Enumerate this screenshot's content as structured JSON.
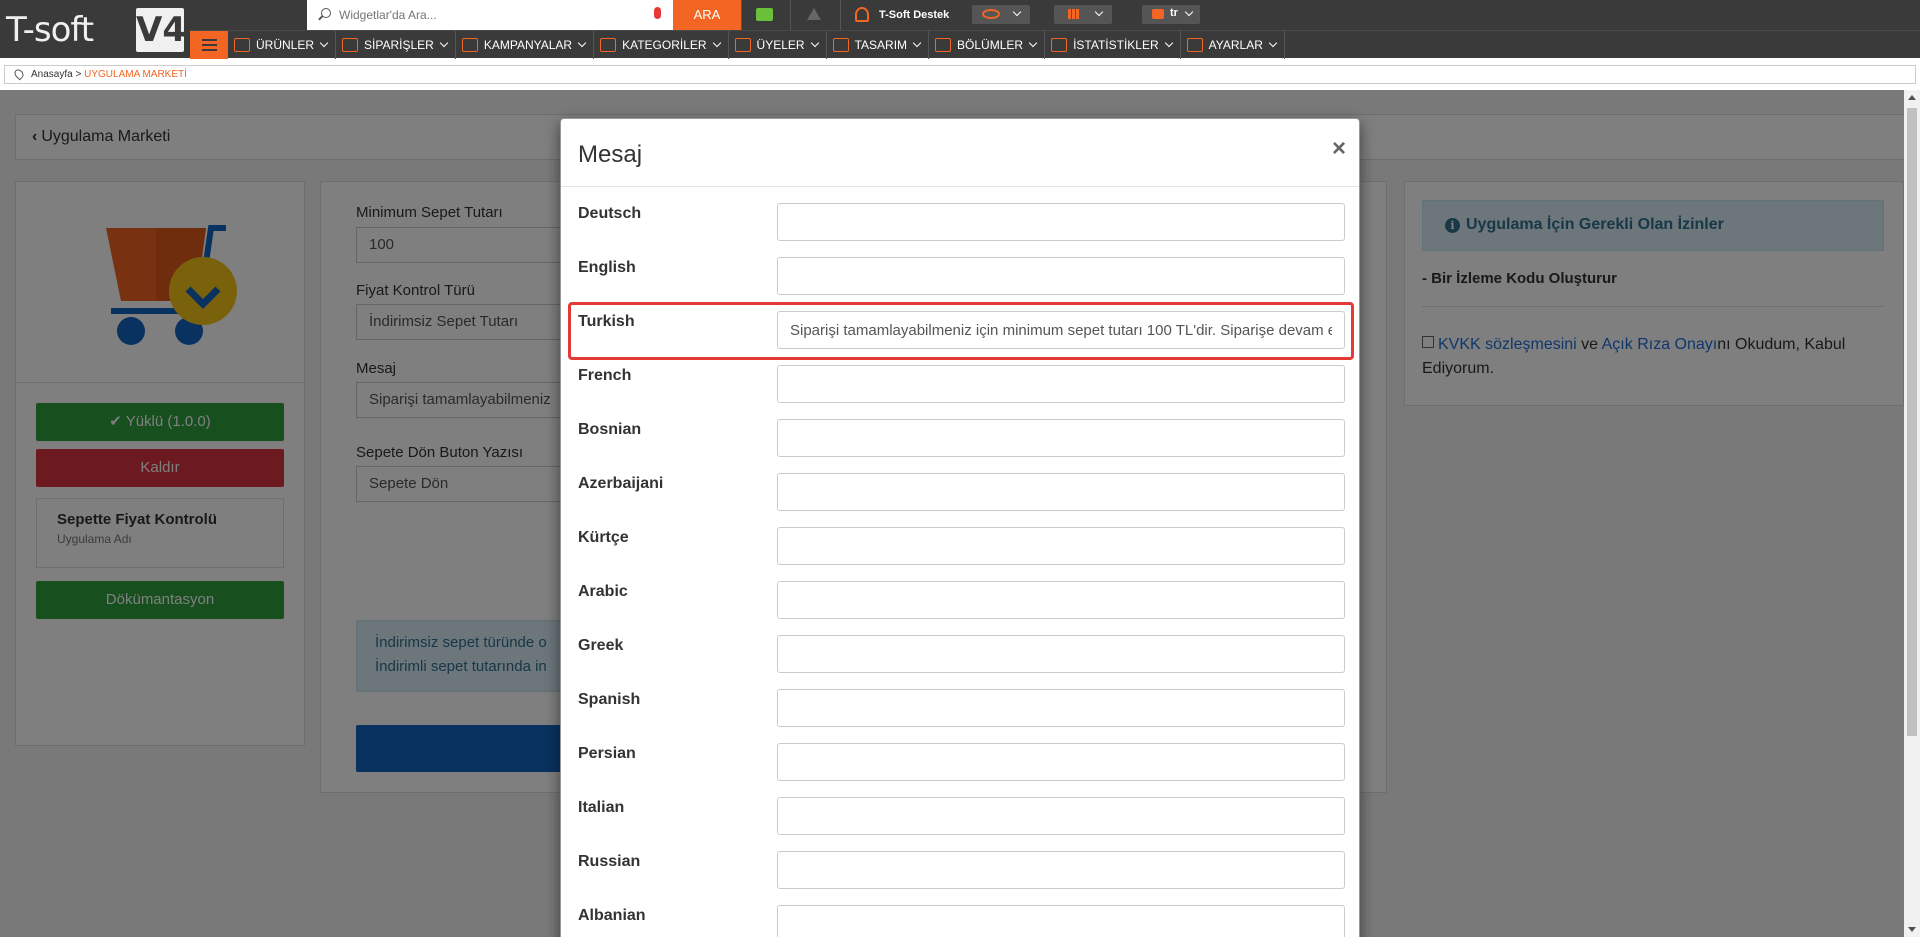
{
  "topbar": {
    "logo_text": "T-soft",
    "logo_version": "V4",
    "search_placeholder": "Widgetlar'da Ara...",
    "search_button": "ARA",
    "support_label": "T-Soft Destek",
    "language": "tr"
  },
  "nav": {
    "items": [
      {
        "label": "ÜRÜNLER",
        "icon": "shirt-icon"
      },
      {
        "label": "SİPARİŞLER",
        "icon": "cart-icon"
      },
      {
        "label": "KAMPANYALAR",
        "icon": "tag-icon"
      },
      {
        "label": "KATEGORİLER",
        "icon": "sitemap-icon"
      },
      {
        "label": "ÜYELER",
        "icon": "users-icon"
      },
      {
        "label": "TASARIM",
        "icon": "brush-icon"
      },
      {
        "label": "BÖLÜMLER",
        "icon": "sections-icon"
      },
      {
        "label": "İSTATİSTİKLER",
        "icon": "chart-icon"
      },
      {
        "label": "AYARLAR",
        "icon": "settings-icon"
      }
    ]
  },
  "breadcrumb": {
    "home": "Anasayfa",
    "separator": " > ",
    "current": "UYGULAMA MARKETİ"
  },
  "page": {
    "back_title": "Uygulama Marketi",
    "installed_label": "Yüklü (1.0.0)",
    "remove_label": "Kaldır",
    "app_name": "Sepette Fiyat Kontrolü",
    "app_name_caption": "Uygulama Adı",
    "docs_label": "Dökümantasyon",
    "form": {
      "min_cart_label": "Minimum Sepet Tutarı",
      "min_cart_value": "100",
      "price_type_label": "Fiyat Kontrol Türü",
      "price_type_value": "İndirimsiz Sepet Tutarı",
      "message_label": "Mesaj",
      "message_value": "Siparişi tamamlayabilmeniz",
      "back_button_label": "Sepete Dön Buton Yazısı",
      "back_button_value": "Sepete Dön",
      "alert_line1": "İndirimsiz sepet türünde o",
      "alert_line2": "İndirimli sepet tutarında in"
    },
    "permissions_title": "Uygulama İçin Gerekli Olan İzinler",
    "permission_item": "- Bir İzleme Kodu Oluşturur",
    "kvkk_link": "KVKK sözleşmesini",
    "kvkk_and": " ve ",
    "consent_link": "Açık Rıza Onayı",
    "kvkk_rest": "nı Okudum, Kabul Ediyorum."
  },
  "modal": {
    "title": "Mesaj",
    "close": "×",
    "rows": [
      {
        "label": "Deutsch",
        "value": ""
      },
      {
        "label": "English",
        "value": ""
      },
      {
        "label": "Turkish",
        "value": "Siparişi tamamlayabilmeniz için minimum sepet tutarı 100 TL'dir. Siparişe devam etmek için lütfen sepetinize ürün ekleyiniz."
      },
      {
        "label": "French",
        "value": ""
      },
      {
        "label": "Bosnian",
        "value": ""
      },
      {
        "label": "Azerbaijani",
        "value": ""
      },
      {
        "label": "Kürtçe",
        "value": ""
      },
      {
        "label": "Arabic",
        "value": ""
      },
      {
        "label": "Greek",
        "value": ""
      },
      {
        "label": "Spanish",
        "value": ""
      },
      {
        "label": "Persian",
        "value": ""
      },
      {
        "label": "Italian",
        "value": ""
      },
      {
        "label": "Russian",
        "value": ""
      },
      {
        "label": "Albanian",
        "value": ""
      }
    ]
  },
  "colors": {
    "brand_orange": "#f26522",
    "dark_bar": "#3a3a3a",
    "success": "#2e9e3e",
    "danger": "#d9323f",
    "highlight": "#e53935"
  }
}
